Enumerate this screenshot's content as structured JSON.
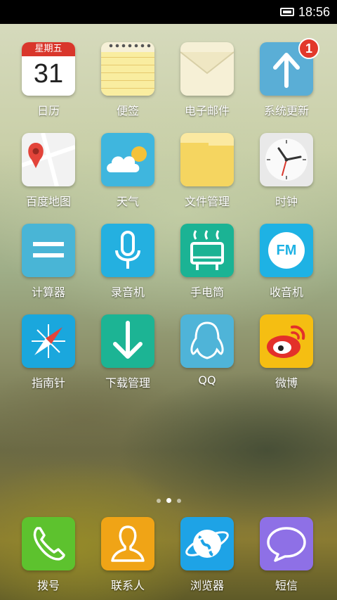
{
  "status_bar": {
    "time": "18:56"
  },
  "calendar": {
    "weekday": "星期五",
    "day": "31"
  },
  "update_badge": "1",
  "apps": [
    {
      "label": "日历"
    },
    {
      "label": "便签"
    },
    {
      "label": "电子邮件"
    },
    {
      "label": "系统更新"
    },
    {
      "label": "百度地图"
    },
    {
      "label": "天气"
    },
    {
      "label": "文件管理"
    },
    {
      "label": "时钟"
    },
    {
      "label": "计算器"
    },
    {
      "label": "录音机"
    },
    {
      "label": "手电筒"
    },
    {
      "label": "收音机"
    },
    {
      "label": "指南针"
    },
    {
      "label": "下载管理"
    },
    {
      "label": "QQ"
    },
    {
      "label": "微博"
    }
  ],
  "radio_text": "FM",
  "page_indicator": {
    "pages": 3,
    "current": 2
  },
  "dock": [
    {
      "label": "拨号"
    },
    {
      "label": "联系人"
    },
    {
      "label": "浏览器"
    },
    {
      "label": "短信"
    }
  ],
  "colors": {
    "calendar_red": "#d9362b",
    "system_update": "#5aaed6",
    "weather": "#3fb6de",
    "calculator": "#49b5d6",
    "recorder": "#24b0e0",
    "flashlight": "#1bb394",
    "radio": "#1eb2e4",
    "compass": "#1aa7dd",
    "download": "#1cb494",
    "qq": "#4fb4d8",
    "weibo": "#f5be12",
    "phone": "#5dc22e",
    "contacts": "#f0a416",
    "browser": "#1ea3e6",
    "sms": "#8e70e6"
  }
}
